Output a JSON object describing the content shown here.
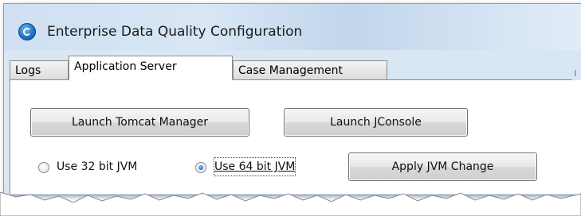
{
  "window": {
    "title": "Enterprise Data Quality Configuration",
    "icon": "edq-app-icon"
  },
  "tabs": [
    {
      "label": "Logs",
      "selected": false
    },
    {
      "label": "Application Server",
      "selected": true
    },
    {
      "label": "Case Management",
      "selected": false
    }
  ],
  "buttons": {
    "tomcat": "Launch Tomcat Manager",
    "jconsole": "Launch JConsole",
    "apply": "Apply JVM Change"
  },
  "jvm_options": [
    {
      "label": "Use 32 bit JVM",
      "selected": false
    },
    {
      "label": "Use 64 bit JVM",
      "selected": true
    }
  ],
  "colors": {
    "titlebar": "#d8e6f5",
    "accent": "#1f6fc4",
    "panel": "#ffffff"
  }
}
